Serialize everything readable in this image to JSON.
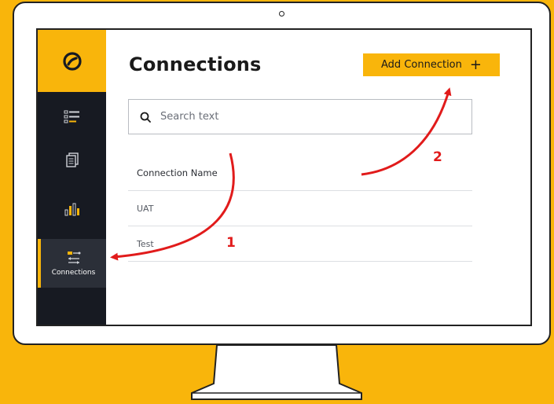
{
  "sidebar": {
    "items": [
      {
        "icon": "list-icon",
        "label": ""
      },
      {
        "icon": "documents-icon",
        "label": ""
      },
      {
        "icon": "bar-chart-icon",
        "label": ""
      },
      {
        "icon": "connections-icon",
        "label": "Connections"
      }
    ]
  },
  "main": {
    "title": "Connections",
    "add_button_label": "Add Connection",
    "search_placeholder": "Search text",
    "table": {
      "header": "Connection Name",
      "rows": [
        "UAT",
        "Test"
      ]
    }
  },
  "annotations": {
    "step1": "1",
    "step2": "2"
  },
  "colors": {
    "background": "#F9B50B",
    "sidebar": "#171a22",
    "accent": "#F9B50B",
    "arrow": "#E11B1B"
  }
}
